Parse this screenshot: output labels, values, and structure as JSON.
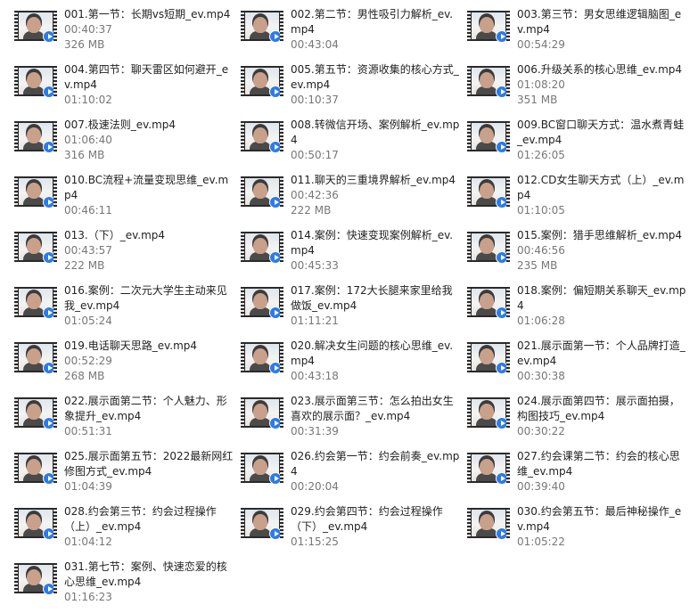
{
  "files": [
    {
      "name": "001.第一节：长期vs短期_ev.mp4",
      "details": [
        "00:40:37",
        "326 MB"
      ]
    },
    {
      "name": "002.第二节：男性吸引力解析_ev.mp4",
      "details": [
        "00:43:04"
      ]
    },
    {
      "name": "003.第三节：男女思维逻辑脑图_ev.mp4",
      "details": [
        "00:54:29"
      ]
    },
    {
      "name": "004.第四节：聊天雷区如何避开_ev.mp4",
      "details": [
        "01:10:02"
      ]
    },
    {
      "name": "005.第五节：资源收集的核心方式_ev.mp4",
      "details": [
        "00:10:37"
      ]
    },
    {
      "name": "006.升级关系的核心思维_ev.mp4",
      "details": [
        "01:08:20",
        "351 MB"
      ]
    },
    {
      "name": "007.极速法则_ev.mp4",
      "details": [
        "01:06:40",
        "316 MB"
      ]
    },
    {
      "name": "008.转微信开场、案例解析_ev.mp4",
      "details": [
        "00:50:17"
      ]
    },
    {
      "name": "009.BC窗口聊天方式：温水煮青蛙_ev.mp4",
      "details": [
        "01:26:05"
      ]
    },
    {
      "name": "010.BC流程+流量变现思维_ev.mp4",
      "details": [
        "00:46:11"
      ]
    },
    {
      "name": "011.聊天的三重境界解析_ev.mp4",
      "details": [
        "00:42:36",
        "222 MB"
      ]
    },
    {
      "name": "012.CD女生聊天方式（上）_ev.mp4",
      "details": [
        "01:10:05"
      ]
    },
    {
      "name": "013.（下）_ev.mp4",
      "details": [
        "00:43:57",
        "222 MB"
      ]
    },
    {
      "name": "014.案例：快速变现案例解析_ev.mp4",
      "details": [
        "00:45:33"
      ]
    },
    {
      "name": "015.案例：猎手思维解析_ev.mp4",
      "details": [
        "00:46:56",
        "235 MB"
      ]
    },
    {
      "name": "016.案例：二次元大学生主动来见我_ev.mp4",
      "details": [
        "01:05:24"
      ]
    },
    {
      "name": "017.案例：172大长腿来家里给我做饭_ev.mp4",
      "details": [
        "01:11:21"
      ]
    },
    {
      "name": "018.案例：偏短期关系聊天_ev.mp4",
      "details": [
        "01:06:28"
      ]
    },
    {
      "name": "019.电话聊天思路_ev.mp4",
      "details": [
        "00:52:29",
        "268 MB"
      ]
    },
    {
      "name": "020.解决女生问题的核心思维_ev.mp4",
      "details": [
        "00:43:18"
      ]
    },
    {
      "name": "021.展示面第一节：个人品牌打造_ev.mp4",
      "details": [
        "00:30:38"
      ]
    },
    {
      "name": "022.展示面第二节：个人魅力、形象提升_ev.mp4",
      "details": [
        "00:51:31"
      ]
    },
    {
      "name": "023.展示面第三节：怎么拍出女生喜欢的展示面？_ev.mp4",
      "details": [
        "00:31:39"
      ]
    },
    {
      "name": "024.展示面第四节：展示面拍摄，构图技巧_ev.mp4",
      "details": [
        "00:30:22"
      ]
    },
    {
      "name": "025.展示面第五节：2022最新网红修图方式_ev.mp4",
      "details": [
        "01:04:39"
      ]
    },
    {
      "name": "026.约会第一节：约会前奏_ev.mp4",
      "details": [
        "00:20:04"
      ]
    },
    {
      "name": "027.约会课第二节：约会的核心思维_ev.mp4",
      "details": [
        "00:39:40"
      ]
    },
    {
      "name": "028.约会第三节：约会过程操作（上）_ev.mp4",
      "details": [
        "01:04:12"
      ]
    },
    {
      "name": "029.约会第四节：约会过程操作（下）_ev.mp4",
      "details": [
        "01:15:25"
      ]
    },
    {
      "name": "030.约会第五节：最后神秘操作_ev.mp4",
      "details": [
        "01:05:22"
      ]
    },
    {
      "name": "031.第七节：案例、快速恋爱的核心思维_ev.mp4",
      "details": [
        "01:16:23"
      ]
    }
  ],
  "icons": {
    "thumbnail": "video-thumbnail-icon",
    "badge": "play-badge-icon"
  },
  "colors": {
    "badge": "#2d7be5",
    "name_text": "#222222",
    "detail_text": "#777777"
  }
}
